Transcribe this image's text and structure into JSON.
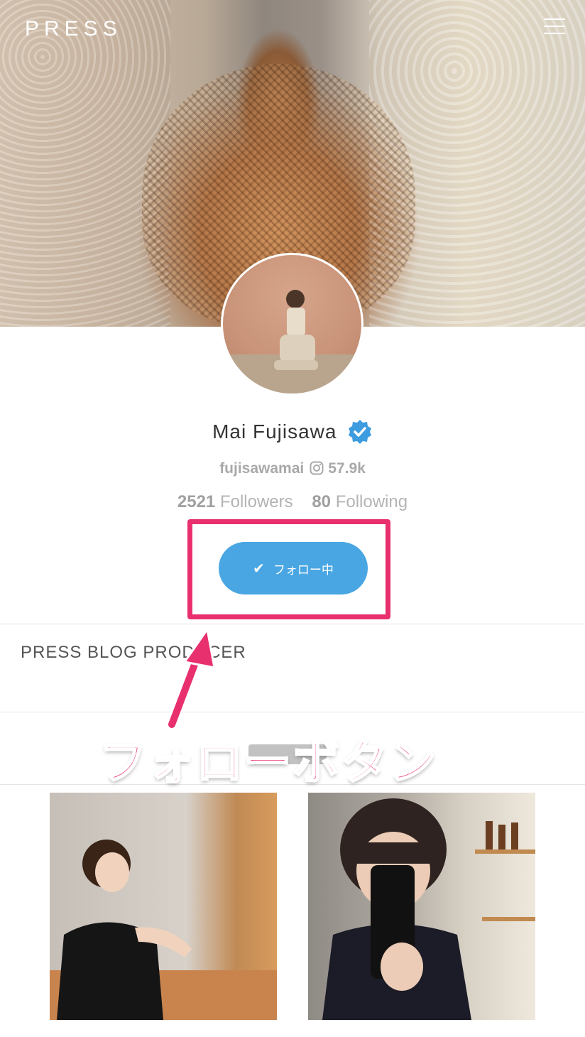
{
  "header": {
    "logo": "PRESS",
    "menu_icon": "hamburger-menu-icon"
  },
  "profile": {
    "name": "Mai Fujisawa",
    "verified_icon": "verified-badge-icon",
    "handle": "fujisawamai",
    "instagram_icon": "instagram-icon",
    "instagram_followers": "57.9k",
    "followers_count": "2521",
    "followers_label": "Followers",
    "following_count": "80",
    "following_label": "Following",
    "follow_button_label": "フォロー中",
    "bio": "PRESS BLOG PRODUCER"
  },
  "annotation": {
    "label": "フォローボタン",
    "color": "#e8306f"
  },
  "colors": {
    "accent": "#49a6e3",
    "highlight": "#e8306f"
  }
}
